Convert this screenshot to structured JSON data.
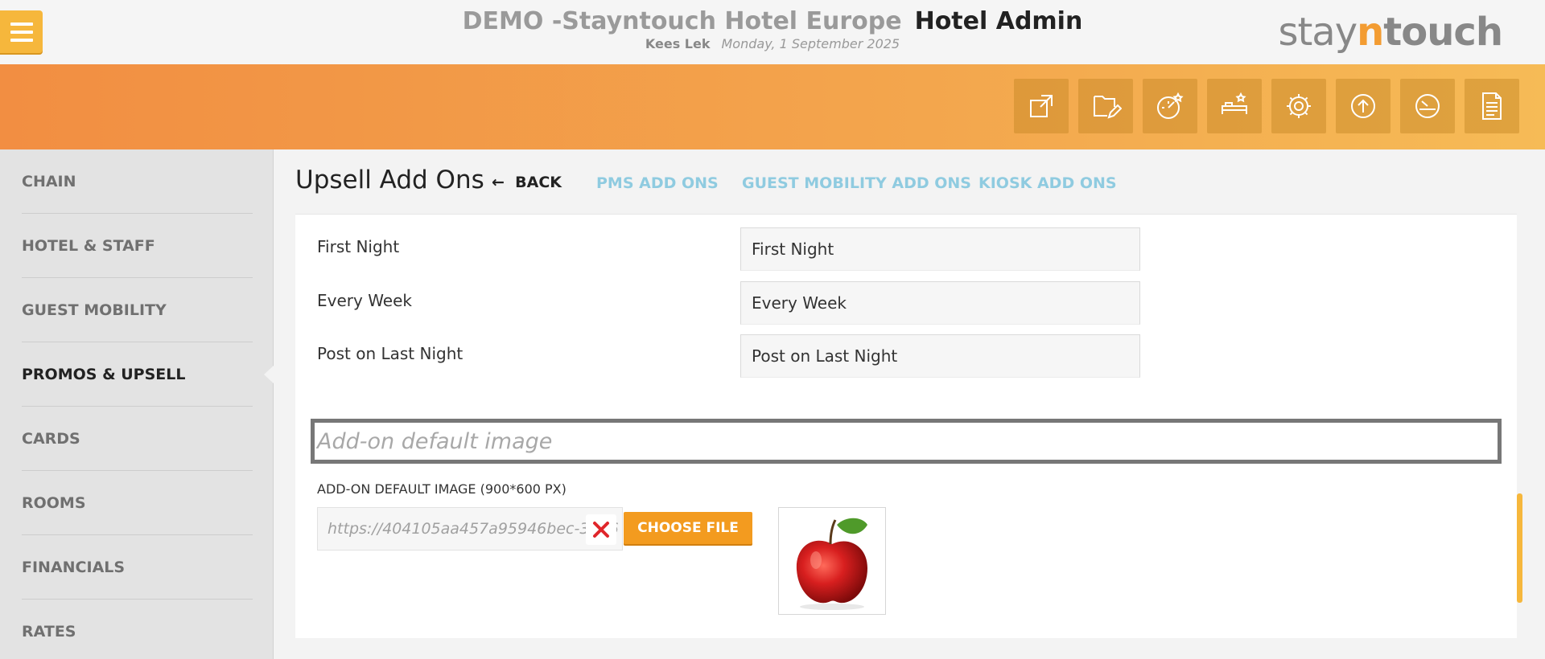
{
  "header": {
    "hotel_name": "DEMO -Stayntouch Hotel Europe",
    "section_name": "Hotel Admin",
    "user": "Kees Lek",
    "date": "Monday, 1 September 2025",
    "logo": {
      "part1": "stay",
      "part2": "n",
      "part3": "touch"
    }
  },
  "toolbar": {
    "icons": [
      "external-link-icon",
      "edit-document-icon",
      "dashboard-star-icon",
      "bed-star-icon",
      "gear-icon",
      "upload-icon",
      "speed-gauge-icon",
      "report-document-icon"
    ]
  },
  "sidebar": {
    "items": [
      {
        "label": "CHAIN"
      },
      {
        "label": "HOTEL & STAFF"
      },
      {
        "label": "GUEST MOBILITY"
      },
      {
        "label": "PROMOS & UPSELL",
        "active": true
      },
      {
        "label": "CARDS"
      },
      {
        "label": "ROOMS"
      },
      {
        "label": "FINANCIALS"
      },
      {
        "label": "RATES"
      }
    ]
  },
  "main": {
    "title": "Upsell Add Ons",
    "back_label": "BACK",
    "tabs": [
      {
        "label": "PMS ADD ONS"
      },
      {
        "label": "GUEST MOBILITY ADD ONS"
      },
      {
        "label": "KIOSK ADD ONS"
      }
    ],
    "rows": [
      {
        "label": "First Night",
        "value": "First Night"
      },
      {
        "label": "Every Week",
        "value": "Every Week"
      },
      {
        "label": "Post on Last Night",
        "value": "Post on Last Night"
      }
    ],
    "section_title": "Add-on default image",
    "image_label": "ADD-ON DEFAULT IMAGE (900*600 PX)",
    "image_url": "https://404105aa457a95946bec-3896",
    "choose_file_label": "CHOOSE FILE"
  },
  "colors": {
    "accent_orange": "#f39b1f",
    "tab_blue": "#8fcbe0",
    "band_start": "#f28e42",
    "band_end": "#f6bb56"
  }
}
